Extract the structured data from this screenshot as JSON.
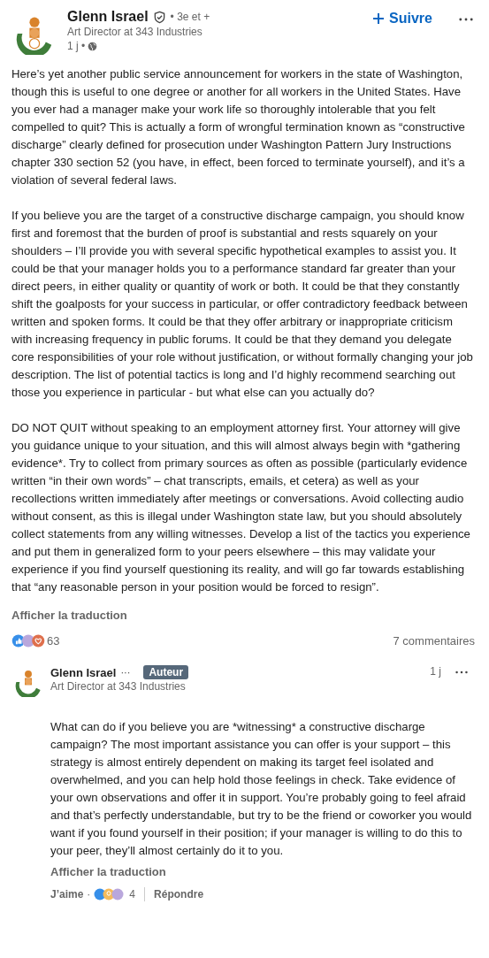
{
  "post": {
    "author": {
      "name": "Glenn Israel",
      "degree": "• 3e et +",
      "headline": "Art Director at 343 Industries",
      "time": "1 j •"
    },
    "follow_button": "Suivre",
    "paragraphs": [
      "Here’s yet another public service announcement for workers in the state of Washington, though this is useful to one degree or another for all workers in the United States. Have you ever had a manager make your work life so thoroughly intolerable that you felt compelled to quit? This is actually a form of wrongful termination known as “constructive discharge” clearly defined for prosecution under Washington Pattern Jury Instructions chapter 330 section 52 (you have, in effect, been forced to terminate yourself), and it’s a violation of several federal laws.",
      "If you believe you are the target of a constructive discharge campaign, you should know first and foremost that the burden of proof is substantial and rests squarely on your shoulders – I’ll provide you with several specific hypothetical examples to assist you. It could be that your manager holds you to a performance standard far greater than your direct peers, in either quality or quantity of work or both. It could be that they constantly shift the goalposts for your success in particular, or offer contradictory feedback between written and spoken forms. It could be that they offer arbitrary or inappropriate criticism with increasing frequency in public forums. It could be that they demand you delegate core responsibilities of your role without justification, or without formally changing your job description. The list of potential tactics is long and I’d highly recommend searching out those you experience in particular - but what else can you actually do?",
      "DO NOT QUIT without speaking to an employment attorney first. Your attorney will give you guidance unique to your situation, and this will almost always begin with *gathering evidence*. Try to collect from primary sources as often as possible (particularly evidence written “in their own words” – chat transcripts, emails, et cetera) as well as your recollections written immediately after meetings or conversations. Avoid collecting audio without consent, as this is illegal under Washington state law, but you should absolutely collect statements from any willing witnesses. Develop a list of the tactics you experience and put them in generalized form to your peers elsewhere – this may validate your experience if you find yourself questioning its reality, and will go far towards establishing that “any reasonable person in your position would be forced to resign”."
    ],
    "translate_link": "Afficher la traduction",
    "reaction_count": "63",
    "comments_count": "7 commentaires"
  },
  "comment": {
    "author": "Glenn Israel",
    "dots": "···",
    "badge": "Auteur",
    "headline": "Art Director at 343 Industries",
    "time": "1 j",
    "text": "What can do if you believe you are *witnessing* a constructive discharge campaign? The most important assistance you can offer is your support – this strategy is almost entirely dependent on making its target feel isolated and overwhelmed, and you can help hold those feelings in check. Take evidence of your own observations and offer it in support. You’re probably going to feel afraid and that’s perfectly understandable, but try to be the friend or coworker you would want if you found yourself in their position; if your manager is willing to do this to your peer, they’ll almost certainly do it to you.",
    "translate_link": "Afficher la traduction",
    "like": "J’aime",
    "sep": "·",
    "reaction_count": "4",
    "reply": "Répondre"
  }
}
